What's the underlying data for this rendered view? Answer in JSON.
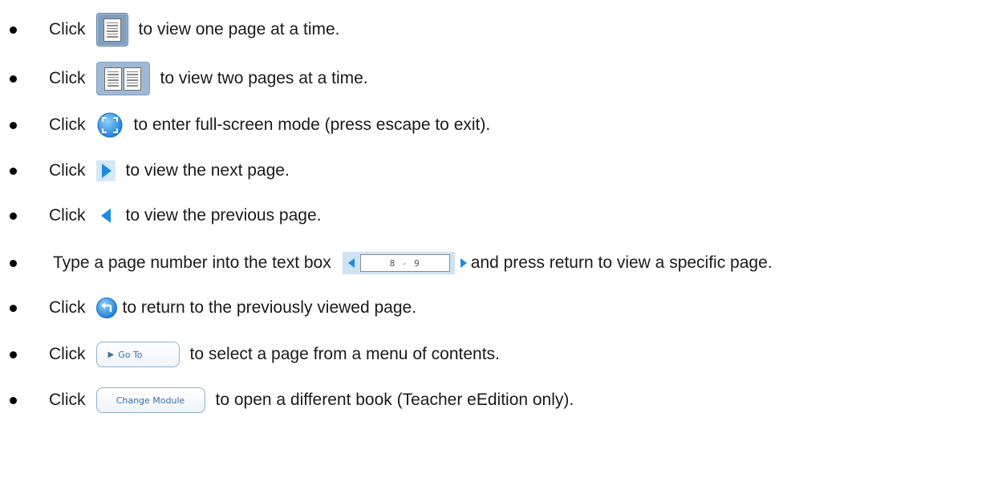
{
  "items": [
    {
      "lead": "Click",
      "icon": "single-page-view-icon",
      "rest": "to view one page at a time."
    },
    {
      "lead": "Click",
      "icon": "two-page-view-icon",
      "rest": "to view two pages at a time."
    },
    {
      "lead": "Click",
      "icon": "fullscreen-icon",
      "rest": "to enter full-screen mode (press escape to exit)."
    },
    {
      "lead": "Click",
      "icon": "next-page-arrow-icon",
      "rest": "to view the next page."
    },
    {
      "lead": "Click",
      "icon": "previous-page-arrow-icon",
      "rest": "to view the previous page."
    },
    {
      "lead": "Type a page number into the text box",
      "icon": "page-number-box",
      "rest": "and press return to view a specific page.",
      "page_box_value": "8 - 9"
    },
    {
      "lead": "Click",
      "icon": "return-icon",
      "rest": "to return to the previously viewed page."
    },
    {
      "lead": "Click",
      "icon": "goto-button",
      "rest": "to select a page from a menu of contents.",
      "button_label": "Go To"
    },
    {
      "lead": "Click",
      "icon": "change-module-button",
      "rest": "to open a different book (Teacher eEdition only).",
      "button_label": "Change Module"
    }
  ],
  "colors": {
    "icon_blue": "#2f8de0",
    "button_text": "#3a6fa8",
    "pager_bg": "#cfe3f5"
  }
}
